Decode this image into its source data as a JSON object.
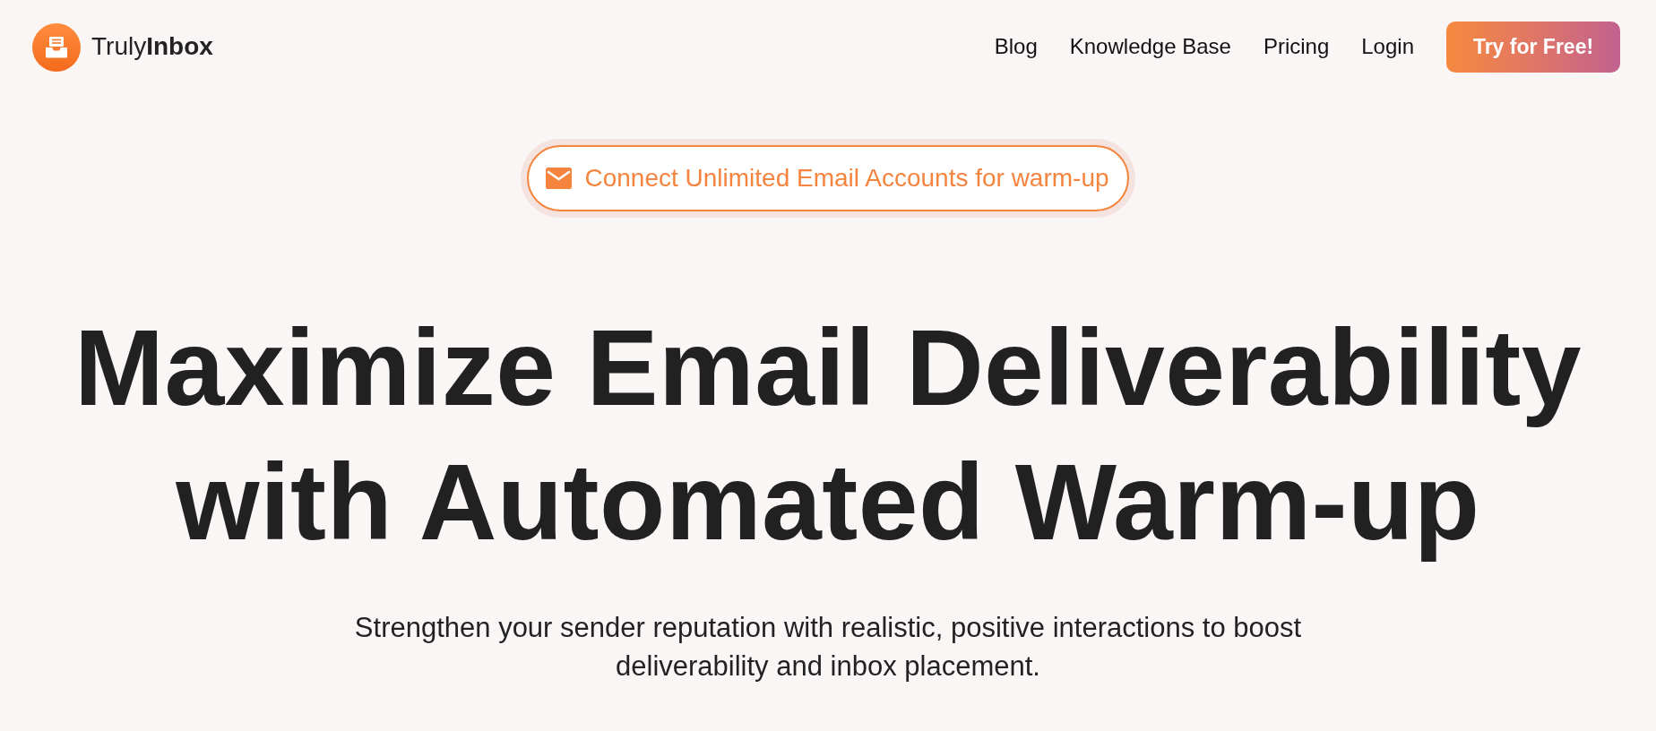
{
  "header": {
    "logo": {
      "text": "Truly**Inbox**"
    },
    "nav": [
      {
        "label": "Blog"
      },
      {
        "label": "Knowledge Base"
      },
      {
        "label": "Pricing"
      },
      {
        "label": "Login"
      }
    ],
    "cta": {
      "label": "Try for Free!"
    }
  },
  "announcement": {
    "text": "Connect Unlimited Email Accounts for warm-up"
  },
  "hero": {
    "headline": "Maximize Email Deliverability with Automated Warm-up",
    "subtitle": "Strengthen your sender reputation with realistic, positive interactions to boost deliverability and inbox placement."
  }
}
